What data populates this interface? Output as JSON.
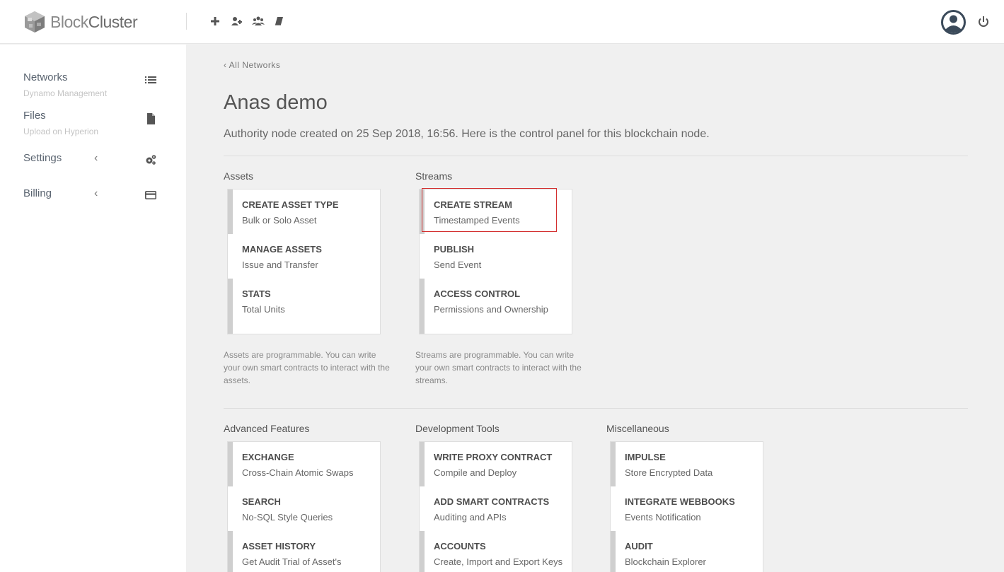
{
  "app": {
    "logo_prefix": "Block",
    "logo_suffix": "Cluster"
  },
  "topbar": {
    "actions": [
      {
        "icon": "plus-icon"
      },
      {
        "icon": "add-user-icon"
      },
      {
        "icon": "users-icon"
      },
      {
        "icon": "book-icon"
      }
    ]
  },
  "sidebar": {
    "items": [
      {
        "title": "Networks",
        "sub": "Dynamo Management",
        "icon": "list-icon"
      },
      {
        "title": "Files",
        "sub": "Upload on Hyperion",
        "icon": "file-icon"
      },
      {
        "title": "Settings",
        "caret": "‹",
        "icon": "gears-icon"
      },
      {
        "title": "Billing",
        "caret": "‹",
        "icon": "credit-card-icon"
      }
    ]
  },
  "main": {
    "back_link": "‹ All Networks",
    "title": "Anas demo",
    "description": "Authority node created on 25 Sep 2018, 16:56. Here is the control panel for this blockchain node.",
    "sections": [
      {
        "title": "Assets",
        "items": [
          {
            "title": "CREATE ASSET TYPE",
            "sub": "Bulk or Solo Asset"
          },
          {
            "title": "MANAGE ASSETS",
            "sub": "Issue and Transfer"
          },
          {
            "title": "STATS",
            "sub": "Total Units"
          }
        ],
        "note": "Assets are programmable. You can write your own smart contracts to interact with the assets."
      },
      {
        "title": "Streams",
        "items": [
          {
            "title": "CREATE STREAM",
            "sub": "Timestamped Events"
          },
          {
            "title": "PUBLISH",
            "sub": "Send Event"
          },
          {
            "title": "ACCESS CONTROL",
            "sub": "Permissions and Ownership"
          }
        ],
        "note": "Streams are programmable. You can write your own smart contracts to interact with the streams."
      },
      {
        "title": "Advanced Features",
        "items": [
          {
            "title": "EXCHANGE",
            "sub": "Cross-Chain Atomic Swaps"
          },
          {
            "title": "SEARCH",
            "sub": "No-SQL Style Queries"
          },
          {
            "title": "ASSET HISTORY",
            "sub": "Get Audit Trial of Asset's"
          }
        ]
      },
      {
        "title": "Development Tools",
        "items": [
          {
            "title": "WRITE PROXY CONTRACT",
            "sub": "Compile and Deploy"
          },
          {
            "title": "ADD SMART CONTRACTS",
            "sub": "Auditing and APIs"
          },
          {
            "title": "ACCOUNTS",
            "sub": "Create, Import and Export Keys"
          }
        ]
      },
      {
        "title": "Miscellaneous",
        "items": [
          {
            "title": "IMPULSE",
            "sub": "Store Encrypted Data"
          },
          {
            "title": "INTEGRATE WEBBOOKS",
            "sub": "Events Notification"
          },
          {
            "title": "AUDIT",
            "sub": "Blockchain Explorer"
          }
        ]
      }
    ]
  },
  "colors": {
    "highlight": "#d32f2f",
    "card_bar": "#cfcfcf",
    "page_bg": "#f0f0f0"
  }
}
